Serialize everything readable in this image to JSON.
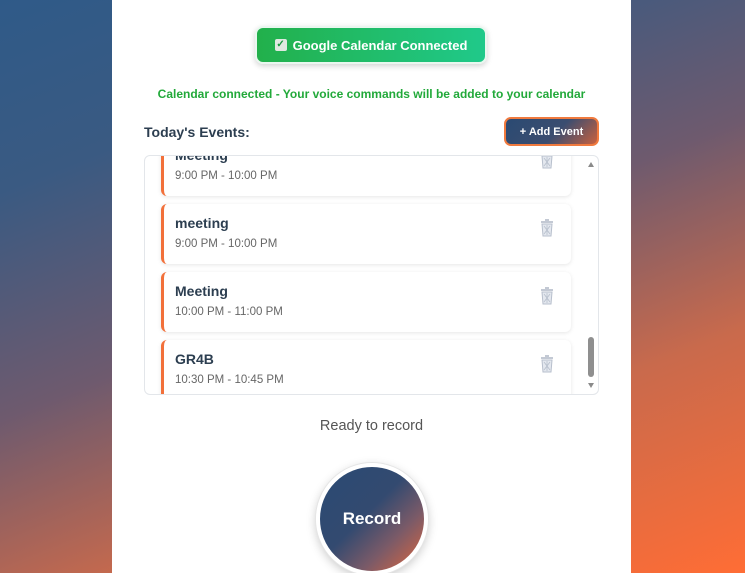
{
  "calendar": {
    "button_label": "Google Calendar Connected",
    "check_glyph": "✓",
    "status_message": "Calendar connected - Your voice commands will be added to your calendar"
  },
  "events": {
    "heading": "Today's Events:",
    "add_button_label": "+ Add Event",
    "items": [
      {
        "title": "Meeting",
        "time": "9:00 PM - 10:00 PM"
      },
      {
        "title": "meeting",
        "time": "9:00 PM - 10:00 PM"
      },
      {
        "title": "Meeting",
        "time": "10:00 PM - 11:00 PM"
      },
      {
        "title": "GR4B",
        "time": "10:30 PM - 10:45 PM"
      }
    ]
  },
  "recorder": {
    "status": "Ready to record",
    "button_label": "Record"
  },
  "colors": {
    "accent_orange": "#f2703a",
    "connected_green": "#22b04b",
    "navy": "#2a4a72"
  },
  "icons": {
    "delete": "trash-icon",
    "connected": "check-icon"
  }
}
